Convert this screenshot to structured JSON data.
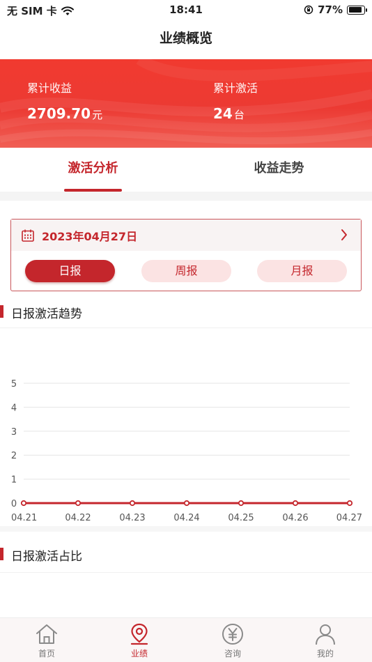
{
  "status_bar": {
    "carrier": "无 SIM 卡",
    "time": "18:41",
    "battery": "77%",
    "battery_level": 0.77
  },
  "nav": {
    "title": "业绩概览"
  },
  "summary": {
    "earnings_label": "累计收益",
    "earnings_value": "2709.70",
    "earnings_unit": "元",
    "activation_label": "累计激活",
    "activation_value": "24",
    "activation_unit": "台"
  },
  "tabs": [
    {
      "label": "激活分析"
    },
    {
      "label": "收益走势"
    }
  ],
  "date_picker": {
    "date": "2023年04月27日"
  },
  "period_buttons": [
    {
      "label": "日报"
    },
    {
      "label": "周报"
    },
    {
      "label": "月报"
    }
  ],
  "sections": {
    "trend_title": "日报激活趋势",
    "ratio_title": "日报激活占比"
  },
  "chart_data": {
    "type": "line",
    "categories": [
      "04.21",
      "04.22",
      "04.23",
      "04.24",
      "04.25",
      "04.26",
      "04.27"
    ],
    "values": [
      0,
      0,
      0,
      0,
      0,
      0,
      0
    ],
    "y_ticks": [
      0,
      1,
      2,
      3,
      4,
      5
    ],
    "ylim": [
      0,
      5
    ],
    "grid": true,
    "line_color": "#c4262c"
  },
  "bottom_tabs": [
    {
      "label": "首页",
      "icon": "home-icon"
    },
    {
      "label": "业绩",
      "icon": "location-pin-icon"
    },
    {
      "label": "咨询",
      "icon": "yuan-coin-icon"
    },
    {
      "label": "我的",
      "icon": "user-icon"
    }
  ],
  "colors": {
    "accent": "#c4262c",
    "banner": "#ec3a33"
  }
}
